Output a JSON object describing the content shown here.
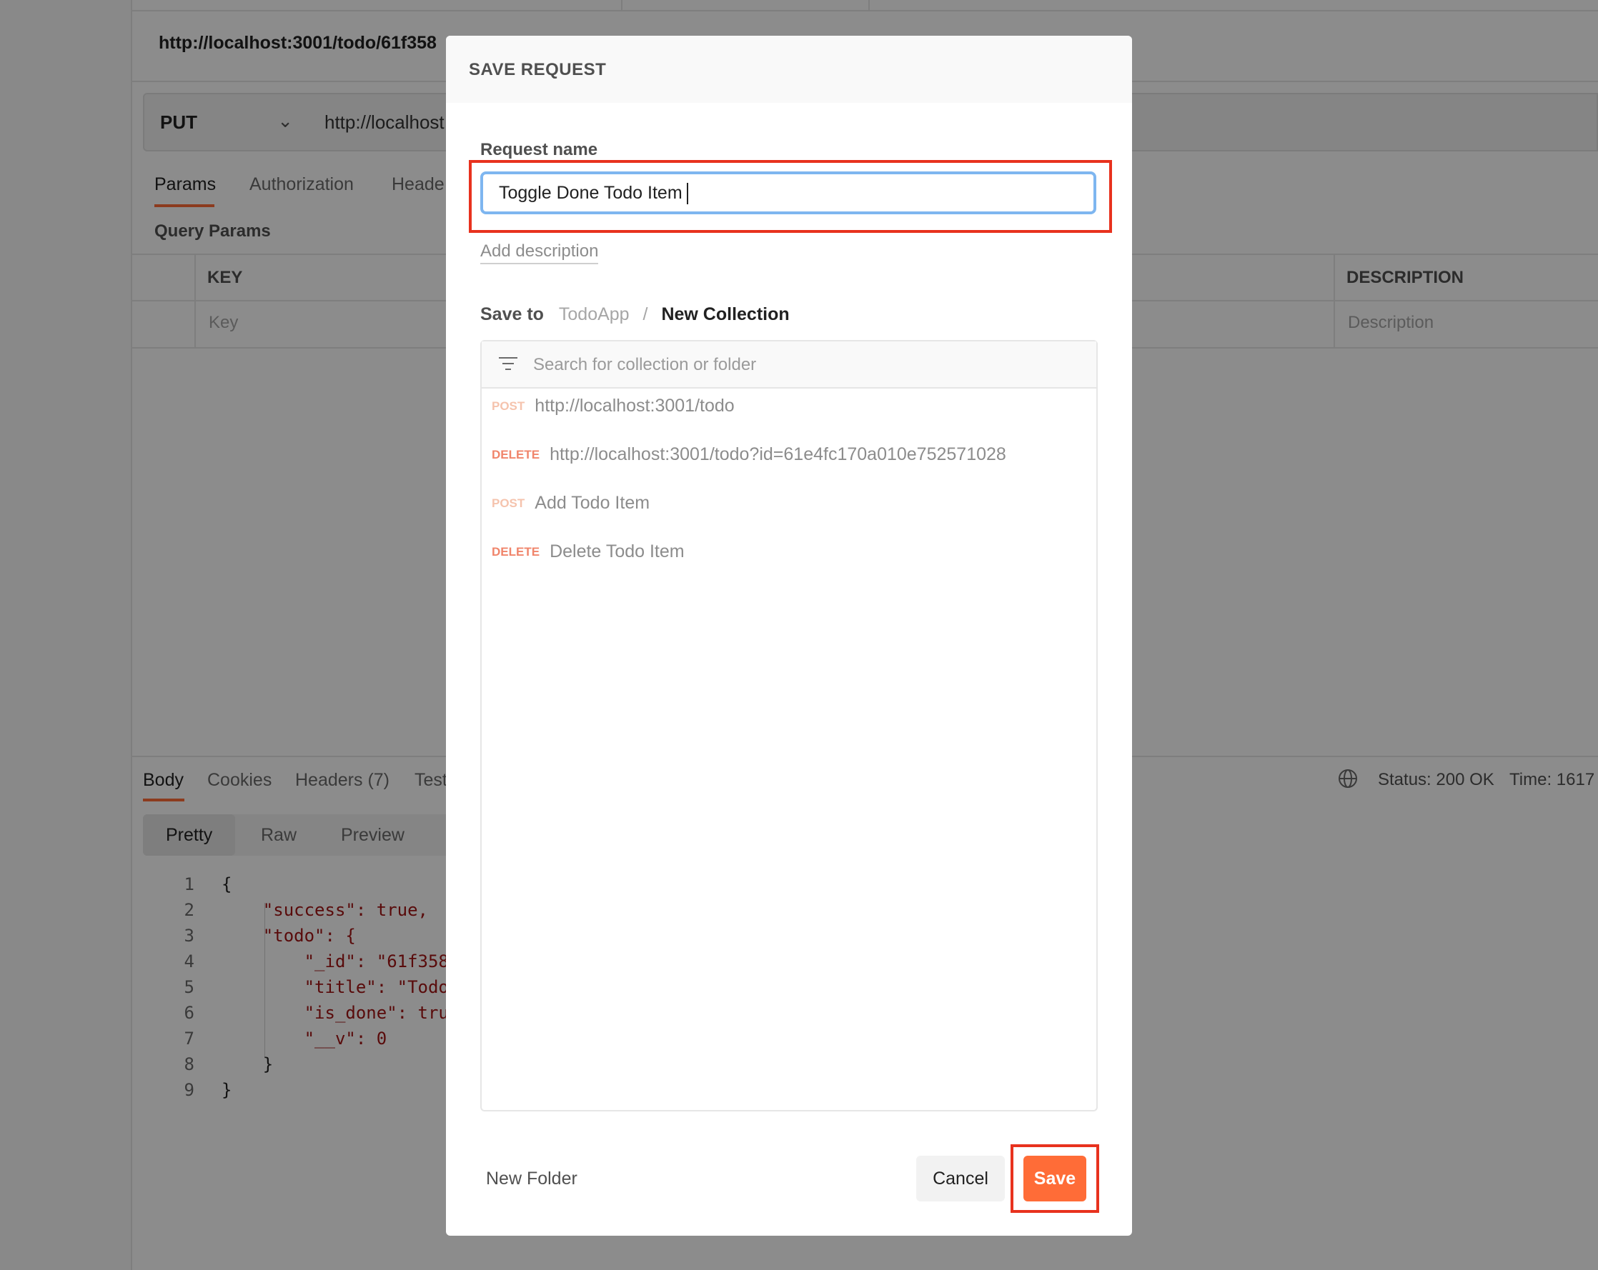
{
  "background": {
    "url_title": "http://localhost:3001/todo/61f358",
    "method": "PUT",
    "url_value": "http://localhost",
    "request_tabs": [
      "Params",
      "Authorization",
      "Heade"
    ],
    "query_params_title": "Query Params",
    "table_headers": {
      "key": "KEY",
      "description": "DESCRIPTION"
    },
    "table_placeholders": {
      "key": "Key",
      "description": "Description"
    },
    "response_tabs": [
      "Body",
      "Cookies",
      "Headers (7)",
      "Test"
    ],
    "status": "Status: 200 OK",
    "time": "Time: 1617",
    "format_tabs": [
      "Pretty",
      "Raw",
      "Preview"
    ],
    "code_lines": [
      {
        "num": "1",
        "text": "{"
      },
      {
        "num": "2",
        "text": "    \"success\": true,"
      },
      {
        "num": "3",
        "text": "    \"todo\": {"
      },
      {
        "num": "4",
        "text": "        \"_id\": \"61f358"
      },
      {
        "num": "5",
        "text": "        \"title\": \"Todo"
      },
      {
        "num": "6",
        "text": "        \"is_done\": tru"
      },
      {
        "num": "7",
        "text": "        \"__v\": 0"
      },
      {
        "num": "8",
        "text": "    }"
      },
      {
        "num": "9",
        "text": "}"
      }
    ]
  },
  "modal": {
    "title": "SAVE REQUEST",
    "request_name_label": "Request name",
    "request_name_value": "Toggle Done Todo Item",
    "add_description": "Add description",
    "save_to_label": "Save to",
    "breadcrumb_parent": "TodoApp",
    "breadcrumb_separator": "/",
    "breadcrumb_current": "New Collection",
    "search_placeholder": "Search for collection or folder",
    "items": [
      {
        "method": "POST",
        "name": "http://localhost:3001/todo"
      },
      {
        "method": "DELETE",
        "name": "http://localhost:3001/todo?id=61e4fc170a010e752571028"
      },
      {
        "method": "POST",
        "name": "Add Todo Item"
      },
      {
        "method": "DELETE",
        "name": "Delete Todo Item"
      }
    ],
    "new_folder_label": "New Folder",
    "cancel_label": "Cancel",
    "save_label": "Save"
  },
  "colors": {
    "accent": "#ff6c37",
    "highlight": "#e8321e",
    "input_focus": "#7eb6f0",
    "post_method": "#f5c3ad",
    "delete_method": "#f0856b"
  }
}
